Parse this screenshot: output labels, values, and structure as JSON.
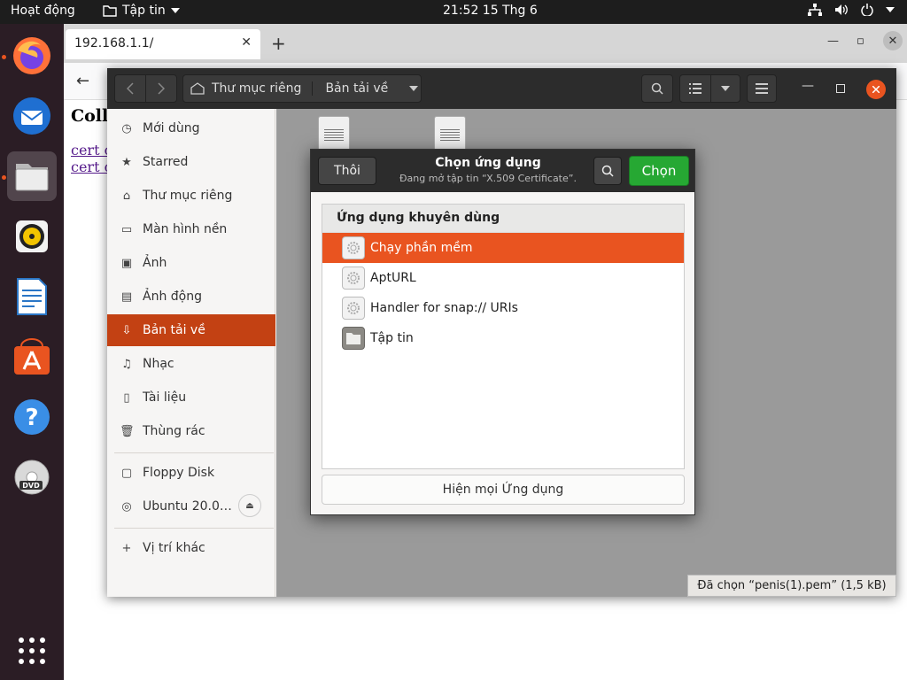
{
  "topbar": {
    "activities": "Hoạt động",
    "app_menu": "Tập tin",
    "clock": "21:52  15 Thg 6"
  },
  "dock": {
    "items": [
      "firefox-icon",
      "thunderbird-icon",
      "files-icon",
      "rhythmbox-icon",
      "libreoffice-writer-icon",
      "ubuntu-software-icon",
      "help-icon",
      "dvd-icon",
      "show-apps-icon"
    ]
  },
  "browser": {
    "tab_title": "192.168.1.1/",
    "page_heading": "Coll",
    "links": [
      "cert c",
      "cert c"
    ]
  },
  "files": {
    "path_home": "Thư mục riêng",
    "path_current": "Bản tải về",
    "sidebar": [
      {
        "label": "Mới dùng",
        "icon": "clock-icon"
      },
      {
        "label": "Starred",
        "icon": "star-icon"
      },
      {
        "label": "Thư mục riêng",
        "icon": "home-icon"
      },
      {
        "label": "Màn hình nền",
        "icon": "desktop-icon"
      },
      {
        "label": "Ảnh",
        "icon": "picture-icon"
      },
      {
        "label": "Ảnh động",
        "icon": "video-icon"
      },
      {
        "label": "Bản tải về",
        "icon": "download-icon"
      },
      {
        "label": "Nhạc",
        "icon": "music-icon"
      },
      {
        "label": "Tài liệu",
        "icon": "document-icon"
      },
      {
        "label": "Thùng rác",
        "icon": "trash-icon"
      },
      {
        "label": "Floppy Disk",
        "icon": "floppy-icon"
      },
      {
        "label": "Ubuntu 20.0…",
        "icon": "disc-icon"
      },
      {
        "label": "Vị trí khác",
        "icon": "plus-icon"
      }
    ],
    "status": "Đã chọn “penis(1).pem”  (1,5 kB)"
  },
  "dialog": {
    "cancel": "Thôi",
    "title": "Chọn ứng dụng",
    "subtitle": "Đang mở tập tin “X.509 Certificate”.",
    "choose": "Chọn",
    "list_header": "Ứng dụng khuyên dùng",
    "apps": [
      {
        "label": "Chạy phần mềm",
        "selected": true
      },
      {
        "label": "AptURL",
        "selected": false
      },
      {
        "label": "Handler for snap:// URIs",
        "selected": false
      },
      {
        "label": "Tập tin",
        "selected": false
      }
    ],
    "show_all": "Hiện mọi Ứng dụng"
  },
  "colors": {
    "accent": "#e95420",
    "selected_sidebar": "#c34113",
    "choose_button": "#26a833"
  }
}
